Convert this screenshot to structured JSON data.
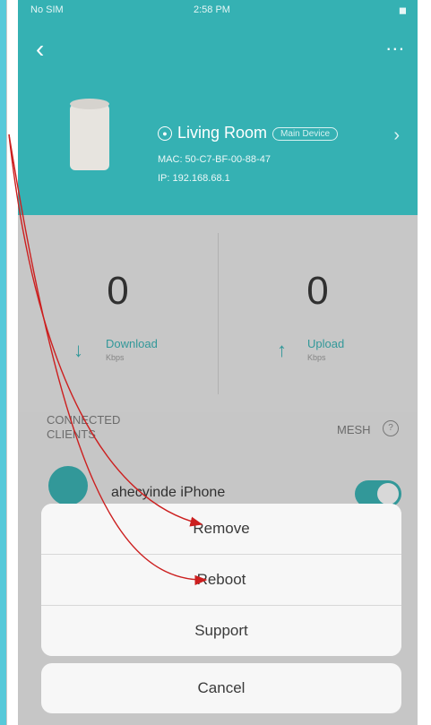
{
  "status_bar": {
    "carrier": "No SIM",
    "time": "2:58 PM",
    "battery": "◼"
  },
  "nav": {
    "back_icon": "chevron-left-icon",
    "more_label": "..."
  },
  "device": {
    "name": "Living Room",
    "badge": "Main Device",
    "mac": "MAC: 50-C7-BF-00-88-47",
    "ip": "IP: 192.168.68.1"
  },
  "stats": {
    "download": {
      "value": "0",
      "label": "Download",
      "unit": "Kbps"
    },
    "upload": {
      "value": "0",
      "label": "Upload",
      "unit": "Kbps"
    }
  },
  "clients": {
    "title": "CONNECTED CLIENTS",
    "mesh_label": "MESH",
    "items": [
      {
        "name": "ahecyinde iPhone"
      }
    ]
  },
  "action_sheet": {
    "items": [
      {
        "label": "Remove"
      },
      {
        "label": "Reboot"
      },
      {
        "label": "Support"
      }
    ],
    "cancel": "Cancel"
  },
  "colors": {
    "accent": "#35b1b3",
    "annotation_arrow": "#cc1f1f"
  }
}
